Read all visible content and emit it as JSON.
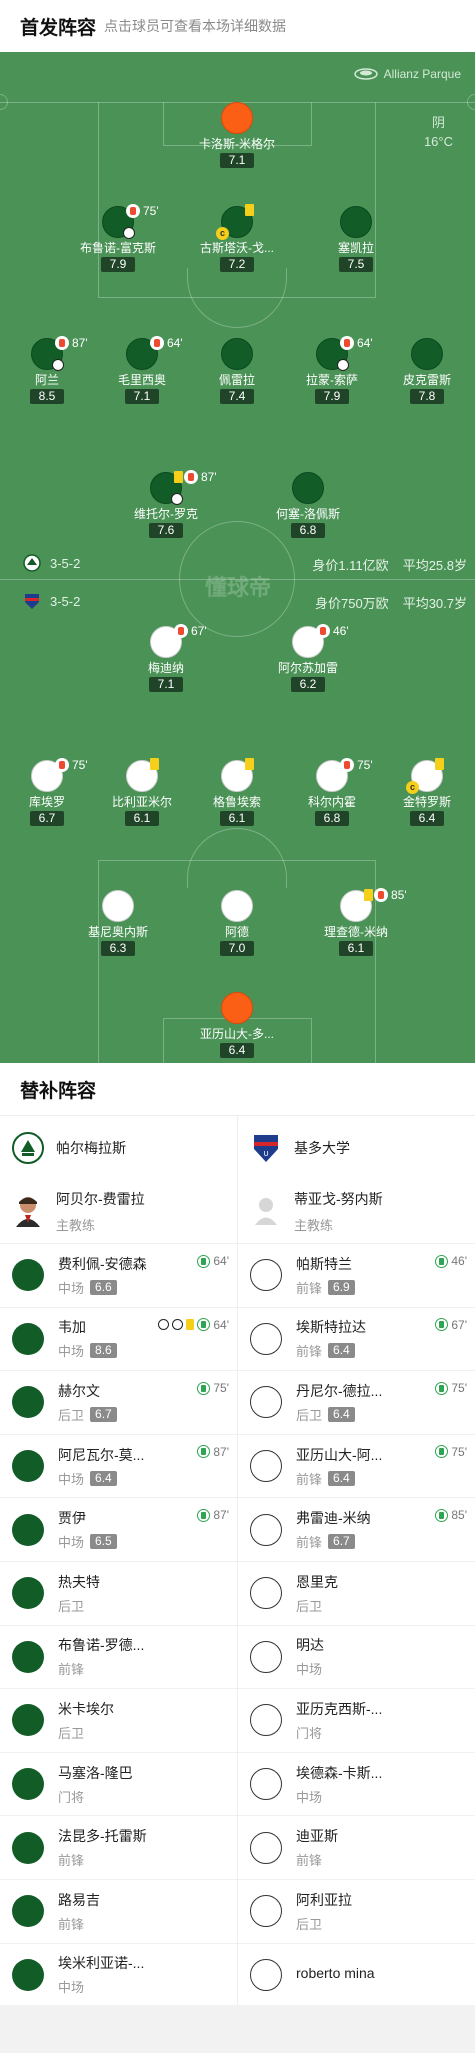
{
  "header": {
    "title": "首发阵容",
    "subtitle": "点击球员可查看本场详细数据"
  },
  "pitch": {
    "venue": "Allianz Parque",
    "weather_desc": "阴",
    "weather_temp": "16°C",
    "watermark": "懂球帝",
    "home_form": "3-5-2",
    "home_value": "身价1.11亿欧",
    "home_age": "平均25.8岁",
    "away_form": "3-5-2",
    "away_value": "身价750万欧",
    "away_age": "平均30.7岁",
    "home_players": [
      {
        "name": "卡洛斯-米格尔",
        "rating": "7.1",
        "kit": "gk"
      },
      {
        "name": "布鲁诺-富克斯",
        "rating": "7.9",
        "kit": "home",
        "sub_min": "75'"
      },
      {
        "name": "古斯塔沃-戈...",
        "rating": "7.2",
        "kit": "home",
        "captain": "c"
      },
      {
        "name": "塞凯拉",
        "rating": "7.5",
        "kit": "home"
      },
      {
        "name": "阿兰",
        "rating": "8.5",
        "kit": "home",
        "sub_min": "87'"
      },
      {
        "name": "毛里西奥",
        "rating": "7.1",
        "kit": "home",
        "sub_min": "64'"
      },
      {
        "name": "佩雷拉",
        "rating": "7.4",
        "kit": "home"
      },
      {
        "name": "拉蒙-索萨",
        "rating": "7.9",
        "kit": "home",
        "sub_min": "64'"
      },
      {
        "name": "皮克雷斯",
        "rating": "7.8",
        "kit": "home"
      },
      {
        "name": "维托尔-罗克",
        "rating": "7.6",
        "kit": "home",
        "sub_min": "87'"
      },
      {
        "name": "何塞-洛佩斯",
        "rating": "6.8",
        "kit": "home"
      }
    ],
    "away_players": [
      {
        "name": "梅迪纳",
        "rating": "7.1",
        "kit": "away",
        "sub_min": "67'"
      },
      {
        "name": "阿尔苏加雷",
        "rating": "6.2",
        "kit": "away",
        "sub_min": "46'"
      },
      {
        "name": "库埃罗",
        "rating": "6.7",
        "kit": "away",
        "sub_min": "75'"
      },
      {
        "name": "比利亚米尔",
        "rating": "6.1",
        "kit": "away"
      },
      {
        "name": "格鲁埃索",
        "rating": "6.1",
        "kit": "away"
      },
      {
        "name": "科尔内霍",
        "rating": "6.8",
        "kit": "away",
        "sub_min": "75'"
      },
      {
        "name": "金特罗斯",
        "rating": "6.4",
        "kit": "away",
        "captain": "c"
      },
      {
        "name": "基尼奥内斯",
        "rating": "6.3",
        "kit": "away"
      },
      {
        "name": "阿德",
        "rating": "7.0",
        "kit": "away"
      },
      {
        "name": "理查德-米纳",
        "rating": "6.1",
        "kit": "away",
        "sub_min": "85'"
      },
      {
        "name": "亚历山大-多...",
        "rating": "6.4",
        "kit": "gk"
      }
    ]
  },
  "subs": {
    "title": "替补阵容",
    "home": {
      "team": "帕尔梅拉斯",
      "coach_name": "阿贝尔-费雷拉",
      "coach_role": "主教练",
      "players": [
        {
          "name": "费利佩-安德森",
          "pos": "中场",
          "rating": "6.6",
          "min": "64'"
        },
        {
          "name": "韦加",
          "pos": "中场",
          "rating": "8.6",
          "min": "64'"
        },
        {
          "name": "赫尔文",
          "pos": "后卫",
          "rating": "6.7",
          "min": "75'"
        },
        {
          "name": "阿尼瓦尔-莫...",
          "pos": "中场",
          "rating": "6.4",
          "min": "87'"
        },
        {
          "name": "贾伊",
          "pos": "中场",
          "rating": "6.5",
          "min": "87'"
        },
        {
          "name": "热夫特",
          "pos": "后卫"
        },
        {
          "name": "布鲁诺-罗德...",
          "pos": "前锋"
        },
        {
          "name": "米卡埃尔",
          "pos": "后卫"
        },
        {
          "name": "马塞洛-隆巴",
          "pos": "门将"
        },
        {
          "name": "法昆多-托雷斯",
          "pos": "前锋"
        },
        {
          "name": "路易吉",
          "pos": "前锋"
        },
        {
          "name": "埃米利亚诺-...",
          "pos": "中场"
        }
      ]
    },
    "away": {
      "team": "基多大学",
      "coach_name": "蒂亚戈-努内斯",
      "coach_role": "主教练",
      "players": [
        {
          "name": "帕斯特兰",
          "pos": "前锋",
          "rating": "6.9",
          "min": "46'"
        },
        {
          "name": "埃斯特拉达",
          "pos": "前锋",
          "rating": "6.4",
          "min": "67'"
        },
        {
          "name": "丹尼尔-德拉...",
          "pos": "后卫",
          "rating": "6.4",
          "min": "75'"
        },
        {
          "name": "亚历山大-阿...",
          "pos": "前锋",
          "rating": "6.4",
          "min": "75'"
        },
        {
          "name": "弗雷迪-米纳",
          "pos": "前锋",
          "rating": "6.7",
          "min": "85'"
        },
        {
          "name": "恩里克",
          "pos": "后卫"
        },
        {
          "name": "明达",
          "pos": "中场"
        },
        {
          "name": "亚历克西斯-...",
          "pos": "门将"
        },
        {
          "name": "埃德森-卡斯...",
          "pos": "中场"
        },
        {
          "name": "迪亚斯",
          "pos": "前锋"
        },
        {
          "name": "阿利亚拉",
          "pos": "后卫"
        },
        {
          "name": "roberto mina",
          "pos": ""
        }
      ]
    }
  },
  "colors": {
    "pitch": "#4a9256",
    "home_kit": "#115c27",
    "away_kit": "#ffffff",
    "gk_kit": "#fb5e15"
  }
}
